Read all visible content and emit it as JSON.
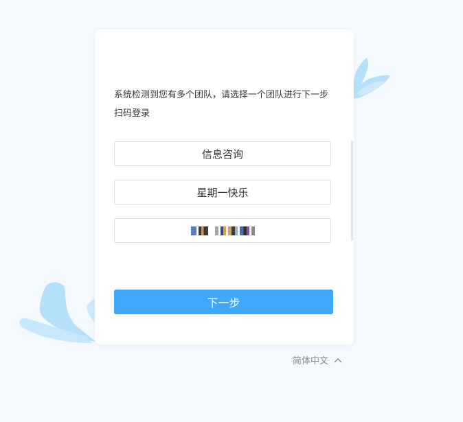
{
  "prompt": {
    "text": "系统检测到您有多个团队，请选择一个团队进行下一步扫码登录"
  },
  "teams": [
    {
      "label": "信息咨询"
    },
    {
      "label": "星期一快乐"
    },
    {
      "label": "",
      "display": "pixelated-name"
    }
  ],
  "actions": {
    "next_label": "下一步"
  },
  "language": {
    "label": "简体中文",
    "icon": "chevron-up-icon"
  },
  "colors": {
    "page_background": "#f4f9fe",
    "accent": "#3fa8fb",
    "splash": "#b5e0fb"
  }
}
